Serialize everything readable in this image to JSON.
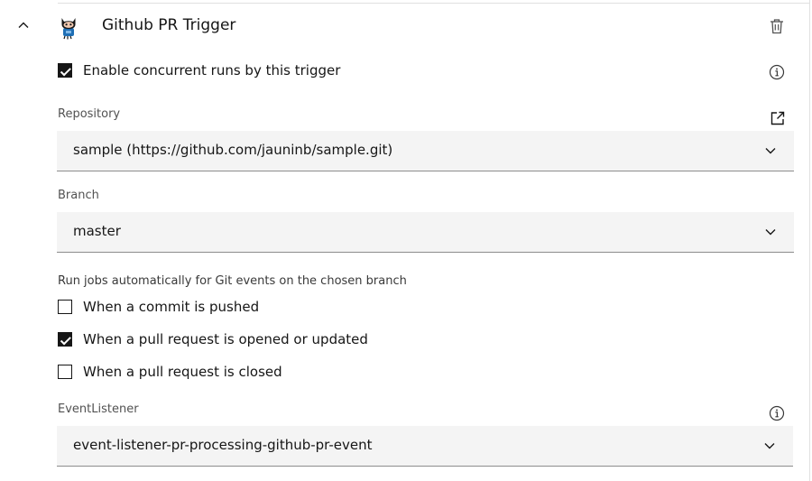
{
  "trigger": {
    "title": "Github PR Trigger",
    "expanded": true,
    "concurrent": {
      "label": "Enable concurrent runs by this trigger",
      "checked": true
    }
  },
  "repository": {
    "label": "Repository",
    "value": "sample (https://github.com/jauninb/sample.git)"
  },
  "branch": {
    "label": "Branch",
    "value": "master"
  },
  "events": {
    "heading": "Run jobs automatically for Git events on the chosen branch",
    "items": [
      {
        "label": "When a commit is pushed",
        "checked": false
      },
      {
        "label": "When a pull request is opened or updated",
        "checked": true
      },
      {
        "label": "When a pull request is closed",
        "checked": false
      }
    ]
  },
  "event_listener": {
    "label": "EventListener",
    "value": "event-listener-pr-processing-github-pr-event"
  },
  "colors": {
    "text": "#161616",
    "label": "#525252",
    "field_bg": "#f4f4f4",
    "field_border": "#8d8d8d",
    "checkbox_checked": "#161616"
  },
  "icons": [
    "chevron-up-icon",
    "github-octocat-icon",
    "trash-icon",
    "information-icon",
    "launch-external-icon",
    "chevron-down-icon"
  ]
}
